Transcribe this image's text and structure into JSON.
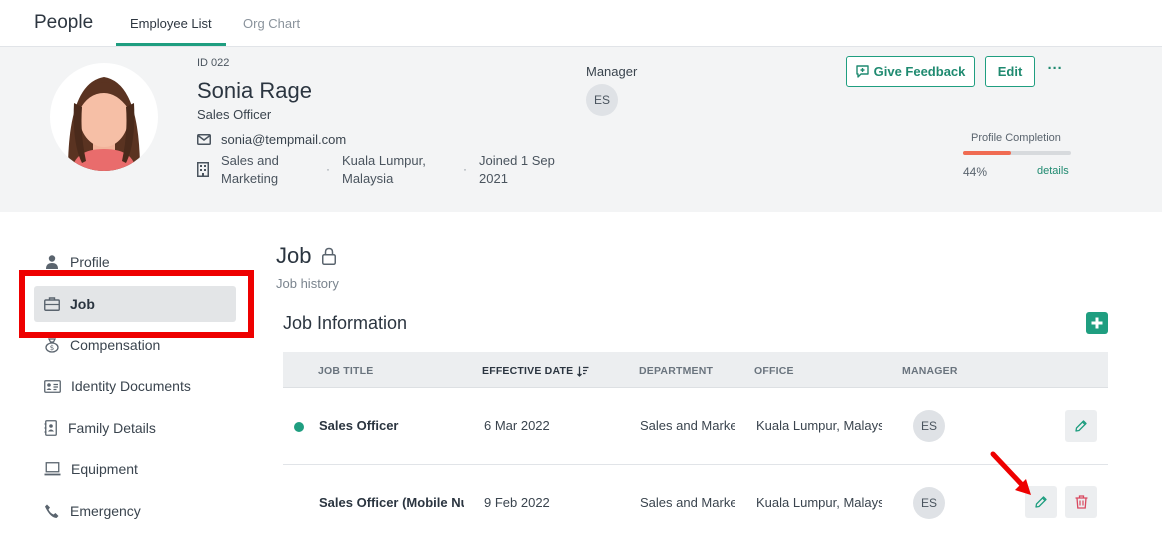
{
  "app": {
    "title": "People"
  },
  "tabs": [
    {
      "label": "Employee List",
      "active": true
    },
    {
      "label": "Org Chart",
      "active": false
    }
  ],
  "employee": {
    "id_label": "ID 022",
    "name": "Sonia Rage",
    "role": "Sales Officer",
    "email": "sonia@tempmail.com",
    "department": "Sales and Marketing",
    "location": "Kuala Lumpur, Malaysia",
    "joined": "Joined 1 Sep 2021",
    "separator": "·"
  },
  "manager": {
    "label": "Manager",
    "initials": "ES"
  },
  "actions": {
    "feedback_label": "Give Feedback",
    "edit_label": "Edit",
    "more_label": "···"
  },
  "profile_completion": {
    "label": "Profile Completion",
    "percent_text": "44%",
    "percent": 44,
    "details_label": "details"
  },
  "sidebar": {
    "items": [
      {
        "label": "Profile",
        "icon": "person-icon",
        "active": false
      },
      {
        "label": "Job",
        "icon": "briefcase-icon",
        "active": true
      },
      {
        "label": "Compensation",
        "icon": "money-bag-icon",
        "active": false
      },
      {
        "label": "Identity Documents",
        "icon": "id-card-icon",
        "active": false
      },
      {
        "label": "Family Details",
        "icon": "contact-book-icon",
        "active": false
      },
      {
        "label": "Equipment",
        "icon": "laptop-icon",
        "active": false
      },
      {
        "label": "Emergency",
        "icon": "phone-icon",
        "active": false
      }
    ]
  },
  "section": {
    "title": "Job",
    "subtitle": "Job history"
  },
  "card": {
    "title": "Job Information"
  },
  "table": {
    "headers": [
      "JOB TITLE",
      "EFFECTIVE DATE",
      "DEPARTMENT",
      "OFFICE",
      "MANAGER"
    ],
    "rows": [
      {
        "job_title": "Sales Officer",
        "effective_date": "6 Mar 2022",
        "department": "Sales and Marketing",
        "office": "Kuala Lumpur, Malaysia",
        "manager": "ES",
        "current": true
      },
      {
        "job_title": "Sales Officer (Mobile Number)",
        "effective_date": "9 Feb 2022",
        "department": "Sales and Marketing",
        "office": "Kuala Lumpur, Malaysia",
        "manager": "ES",
        "current": false
      }
    ]
  },
  "colors": {
    "accent": "#1f9e80",
    "highlight": "#ee0000",
    "progress": "#f06b52",
    "delete": "#d9485f"
  }
}
